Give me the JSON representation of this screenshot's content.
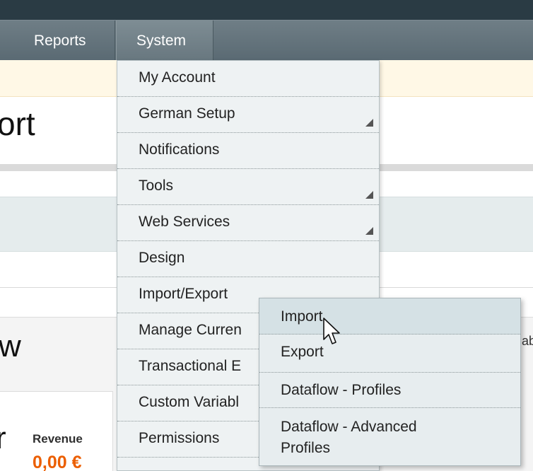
{
  "nav": {
    "items": [
      {
        "label": "Reports"
      },
      {
        "label": "System"
      }
    ]
  },
  "background": {
    "big_word_1": "ort",
    "big_word_2": "w",
    "big_word_3": "r",
    "revenue_label": "Revenue",
    "revenue_value": "0,00 €",
    "side_clip": "ab"
  },
  "system_menu": {
    "items": [
      {
        "label": "My Account",
        "has_submenu": false
      },
      {
        "label": "German Setup",
        "has_submenu": true
      },
      {
        "label": "Notifications",
        "has_submenu": false
      },
      {
        "label": "Tools",
        "has_submenu": true
      },
      {
        "label": "Web Services",
        "has_submenu": true
      },
      {
        "label": "Design",
        "has_submenu": false
      },
      {
        "label": "Import/Export",
        "has_submenu": true
      },
      {
        "label": "Manage Curren",
        "has_submenu": false
      },
      {
        "label": "Transactional E",
        "has_submenu": false
      },
      {
        "label": "Custom Variabl",
        "has_submenu": false
      },
      {
        "label": "Permissions",
        "has_submenu": false
      }
    ]
  },
  "import_export_submenu": {
    "items": [
      {
        "label": "Import",
        "hovered": true
      },
      {
        "label": "Export"
      },
      {
        "label": "Dataflow - Profiles"
      },
      {
        "label": "Dataflow - Advanced Profiles"
      }
    ]
  },
  "colors": {
    "nav_bg": "#5a6a73",
    "menu_bg": "#eef2f3",
    "hover_bg": "#d5e1e5",
    "revenue_accent": "#eb5e00"
  },
  "icons": {
    "submenu_indicator": "corner-triangle-icon",
    "cursor": "arrow-pointer-icon"
  }
}
